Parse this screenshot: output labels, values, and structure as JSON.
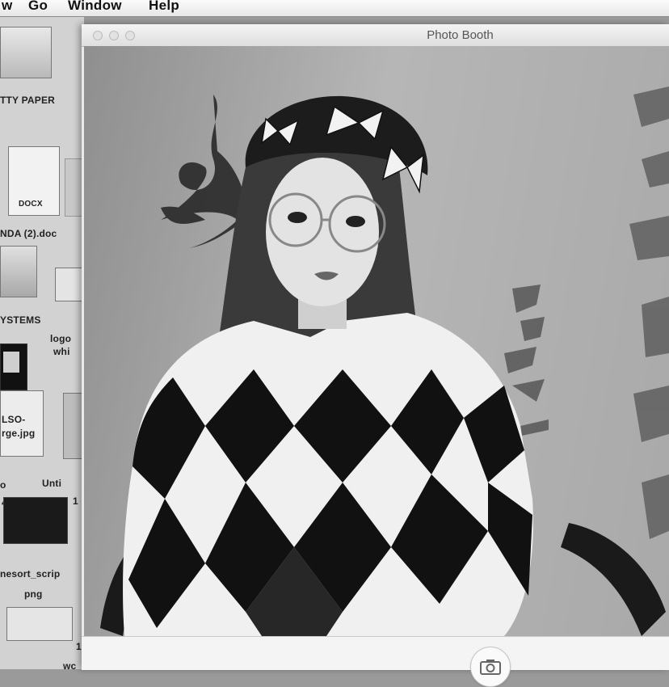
{
  "menubar": {
    "items": [
      "w",
      "Go",
      "Window",
      "Help"
    ]
  },
  "desktop": {
    "labels": [
      "TTY PAPER",
      "DOCX",
      "NDA (2).doc",
      "YSTEMS",
      "logo",
      "whi",
      "LSO-",
      "rge.jpg",
      "o",
      "Unti",
      "4",
      "1",
      "nesort_scrip",
      "png",
      "1",
      "wc"
    ]
  },
  "window": {
    "title": "Photo Booth",
    "shutter_icon": "camera-icon"
  }
}
